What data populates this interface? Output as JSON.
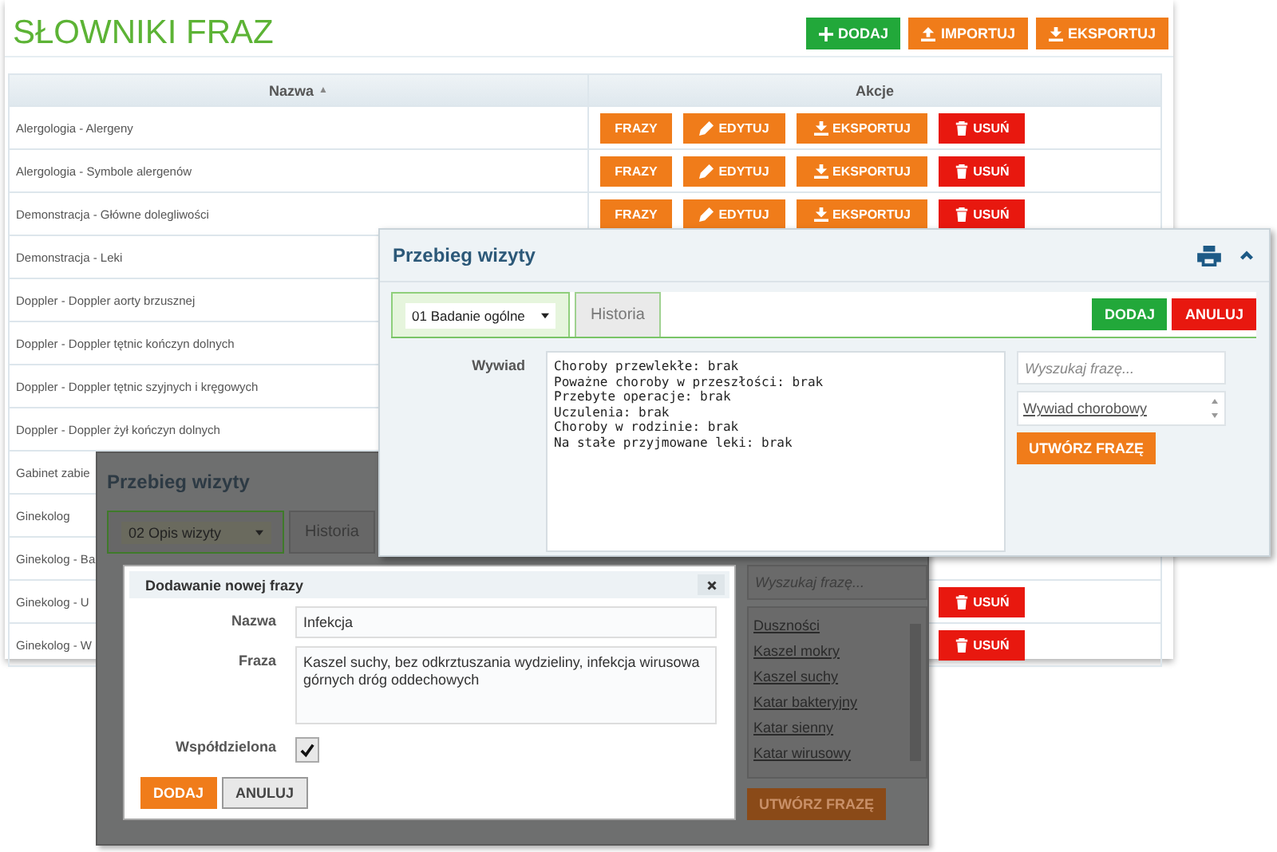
{
  "page": {
    "title": "SŁOWNIKI FRAZ",
    "toolbar": [
      {
        "kind": "add",
        "label": "DODAJ"
      },
      {
        "kind": "import",
        "label": "IMPORTUJ"
      },
      {
        "kind": "export",
        "label": "EKSPORTUJ"
      }
    ]
  },
  "table": {
    "columns": [
      {
        "label": "Nazwa",
        "sort_mark": "▲"
      },
      {
        "label": "Akcje"
      }
    ],
    "rows": [
      {
        "name": "Alergologia - Alergeny",
        "actions": [
          {
            "kind": "phrases",
            "label": "FRAZY"
          },
          {
            "kind": "edit",
            "label": "EDYTUJ"
          },
          {
            "kind": "export",
            "label": "EKSPORTUJ"
          },
          {
            "kind": "delete",
            "label": "USUŃ"
          }
        ]
      },
      {
        "name": "Alergologia - Symbole alergenów",
        "actions": [
          {
            "kind": "phrases",
            "label": "FRAZY"
          },
          {
            "kind": "edit",
            "label": "EDYTUJ"
          },
          {
            "kind": "export",
            "label": "EKSPORTUJ"
          },
          {
            "kind": "delete",
            "label": "USUŃ"
          }
        ]
      },
      {
        "name": "Demonstracja - Główne dolegliwości",
        "actions": [
          {
            "kind": "phrases",
            "label": "FRAZY"
          },
          {
            "kind": "edit",
            "label": "EDYTUJ"
          },
          {
            "kind": "export",
            "label": "EKSPORTUJ"
          },
          {
            "kind": "delete",
            "label": "USUŃ"
          }
        ]
      },
      {
        "name": "Demonstracja - Leki"
      },
      {
        "name": "Doppler - Doppler aorty brzusznej"
      },
      {
        "name": "Doppler - Doppler tętnic kończyn dolnych"
      },
      {
        "name": "Doppler - Doppler tętnic szyjnych i kręgowych"
      },
      {
        "name": "Doppler - Doppler żył kończyn dolnych"
      },
      {
        "name": "Gabinet zabie"
      },
      {
        "name": "Ginekolog"
      },
      {
        "name": "Ginekolog - Ba"
      },
      {
        "name": "Ginekolog - U",
        "actions": [
          {
            "kind": "delete",
            "label": "USUŃ"
          }
        ]
      },
      {
        "name": "Ginekolog - W",
        "actions": [
          {
            "kind": "delete",
            "label": "USUŃ"
          }
        ]
      }
    ]
  },
  "visit_panel": {
    "title": "Przebieg wizyty",
    "tabs": [
      {
        "kind": "select",
        "label": "01 Badanie ogólne",
        "selected": true
      },
      {
        "kind": "tab",
        "label": "Historia",
        "selected": false
      }
    ],
    "buttons": [
      {
        "kind": "add",
        "label": "DODAJ"
      },
      {
        "kind": "cancel",
        "label": "ANULUJ"
      }
    ],
    "field_label": "Wywiad",
    "text": "Choroby przewlekłe: brak\nPoważne choroby w przeszłości: brak\nPrzebyte operacje: brak\nUczulenia: brak\nChoroby w rodzinie: brak\nNa stałe przyjmowane leki: brak",
    "search": {
      "placeholder": "Wyszukaj frazę..."
    },
    "phrases": [
      "Wywiad chorobowy"
    ],
    "create_button": "UTWÓRZ FRAZĘ"
  },
  "background_panel": {
    "title": "Przebieg wizyty",
    "tabs": [
      {
        "kind": "select",
        "label": "02 Opis wizyty",
        "selected": true
      },
      {
        "kind": "tab",
        "label": "Historia",
        "selected": false
      }
    ],
    "search": {
      "placeholder": "Wyszukaj frazę..."
    },
    "phrases": [
      "Duszności",
      "Kaszel mokry",
      "Kaszel suchy",
      "Katar bakteryjny",
      "Katar sienny",
      "Katar wirusowy"
    ],
    "create_button": "UTWÓRZ FRAZĘ"
  },
  "dialog": {
    "title": "Dodawanie nowej frazy",
    "name": {
      "label": "Nazwa",
      "value": "Infekcja"
    },
    "phrase": {
      "label": "Fraza",
      "value": "Kaszel suchy, bez odkrztuszania wydzieliny, infekcja wirusowa górnych dróg oddechowych"
    },
    "shared": {
      "label": "Współdzielona",
      "checked": true
    },
    "buttons": [
      {
        "kind": "add",
        "label": "DODAJ"
      },
      {
        "kind": "cancel",
        "label": "ANULUJ"
      }
    ]
  }
}
